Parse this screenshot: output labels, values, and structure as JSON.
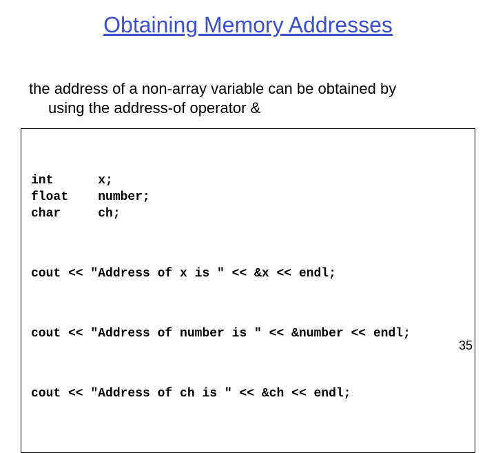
{
  "title": "Obtaining Memory Addresses",
  "body": {
    "line1": "the address of a non-array variable can be obtained by",
    "line2": "using the address-of operator &"
  },
  "code": {
    "decl1": "int      x;",
    "decl2": "float    number;",
    "decl3": "char     ch;",
    "stmt1": "cout << \"Address of x is \" << &x << endl;",
    "stmt2": "cout << \"Address of number is \" << &number << endl;",
    "stmt3": "cout << \"Address of ch is \" << &ch << endl;"
  },
  "page_number": "35"
}
